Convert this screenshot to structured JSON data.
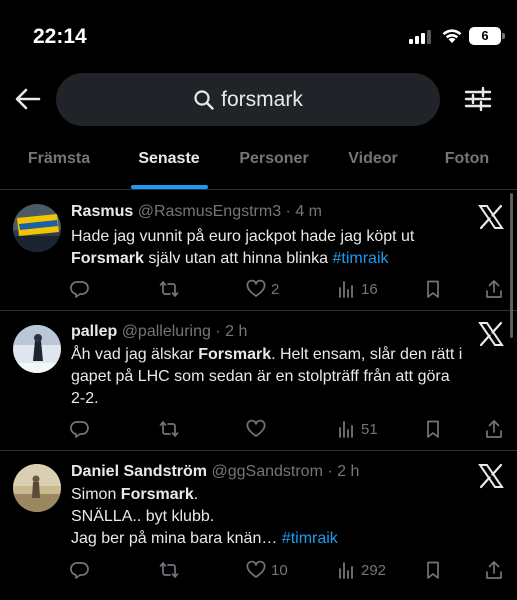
{
  "status_bar": {
    "time": "22:14",
    "battery": "6"
  },
  "search": {
    "query": "forsmark"
  },
  "tabs": [
    {
      "label": "Främsta"
    },
    {
      "label": "Senaste"
    },
    {
      "label": "Personer"
    },
    {
      "label": "Videor"
    },
    {
      "label": "Foton"
    }
  ],
  "active_tab": "Senaste",
  "colors": {
    "accent": "#1d9bf0",
    "background": "#000000",
    "muted": "#71767b"
  },
  "tweets": [
    {
      "name": "Rasmus",
      "handle": "@RasmusEngstrm3",
      "time": "4 m",
      "text_lines": [
        [
          "Hade jag vunnit på euro jackpot hade jag köpt ut"
        ],
        [
          "Forsmark",
          " själv utan att hinna blinka ",
          "#timraik"
        ]
      ],
      "replies": "",
      "retweets": "",
      "likes": "2",
      "views": "16"
    },
    {
      "name": "pallep",
      "handle": "@palleluring",
      "time": "2 h",
      "text_lines": [
        [
          "Åh vad jag älskar ",
          "Forsmark",
          ". Helt ensam, slår den rätt i"
        ],
        [
          "gapet på LHC som sedan är en stolpträff från att göra"
        ],
        [
          "2-2."
        ]
      ],
      "replies": "",
      "retweets": "",
      "likes": "",
      "views": "51"
    },
    {
      "name": "Daniel Sandström",
      "handle": "@ggSandstrom",
      "time": "2 h",
      "text_lines": [
        [
          "Simon ",
          "Forsmark",
          "."
        ],
        [
          "SNÄLLA.. byt klubb."
        ],
        [
          "Jag ber på mina bara knän… ",
          "#timraik"
        ]
      ],
      "replies": "",
      "retweets": "",
      "likes": "10",
      "views": "292"
    }
  ]
}
